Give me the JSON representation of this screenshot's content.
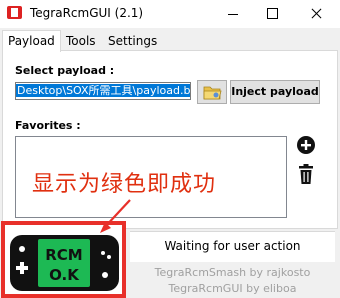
{
  "window": {
    "title": "TegraRcmGUI (2.1)"
  },
  "tabs": [
    {
      "label": "Payload",
      "active": true
    },
    {
      "label": "Tools",
      "active": false
    },
    {
      "label": "Settings",
      "active": false
    }
  ],
  "payload": {
    "select_label": "Select payload :",
    "path_value": "Desktop\\SOX所需工具\\payload.bin",
    "browse_icon": "folder-icon",
    "inject_label": "Inject payload",
    "favorites_label": "Favorites :",
    "add_icon": "plus-circle-icon",
    "delete_icon": "trash-icon"
  },
  "annotation": {
    "text": "显示为绿色即成功",
    "color": "#e03010"
  },
  "status": {
    "rcm_text_line1": "RCM",
    "rcm_text_line2": "O.K",
    "rcm_color": "#1db954",
    "message": "Waiting for user action"
  },
  "footer": {
    "line1": "TegraRcmSmash by rajkosto",
    "line2": "TegraRcmGUI by eliboa"
  }
}
